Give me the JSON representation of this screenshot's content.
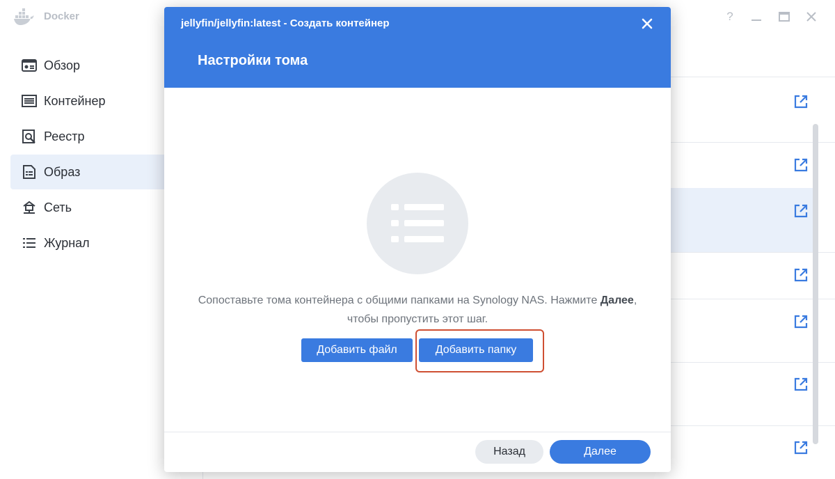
{
  "app": {
    "title": "Docker",
    "help_glyph": "?",
    "icons": {
      "logo": "docker-whale-icon",
      "help": "help-icon",
      "minimize": "minimize-icon",
      "maximize": "maximize-icon",
      "close": "close-icon"
    }
  },
  "sidebar": {
    "items": [
      {
        "label": "Обзор",
        "icon": "overview-icon",
        "active": false
      },
      {
        "label": "Контейнер",
        "icon": "container-icon",
        "active": false
      },
      {
        "label": "Реестр",
        "icon": "registry-icon",
        "active": false
      },
      {
        "label": "Образ",
        "icon": "image-icon",
        "active": true
      },
      {
        "label": "Сеть",
        "icon": "network-icon",
        "active": false
      },
      {
        "label": "Журнал",
        "icon": "log-icon",
        "active": false
      }
    ]
  },
  "content": {
    "row_icon": "external-link-icon"
  },
  "modal": {
    "title": "jellyfin/jellyfin:latest - Создать контейнер",
    "subtitle": "Настройки тома",
    "description_part1": "Сопоставьте тома контейнера с общими папками на Synology NAS. Нажмите ",
    "description_bold": "Далее",
    "description_part2": ", чтобы пропустить этот шаг.",
    "add_file_label": "Добавить файл",
    "add_folder_label": "Добавить папку",
    "back_label": "Назад",
    "next_label": "Далее",
    "illustration_icon": "list-icon"
  },
  "colors": {
    "accent": "#3a7be0",
    "highlight_box": "#cf4f32",
    "selected_row": "#e9f0fa"
  }
}
